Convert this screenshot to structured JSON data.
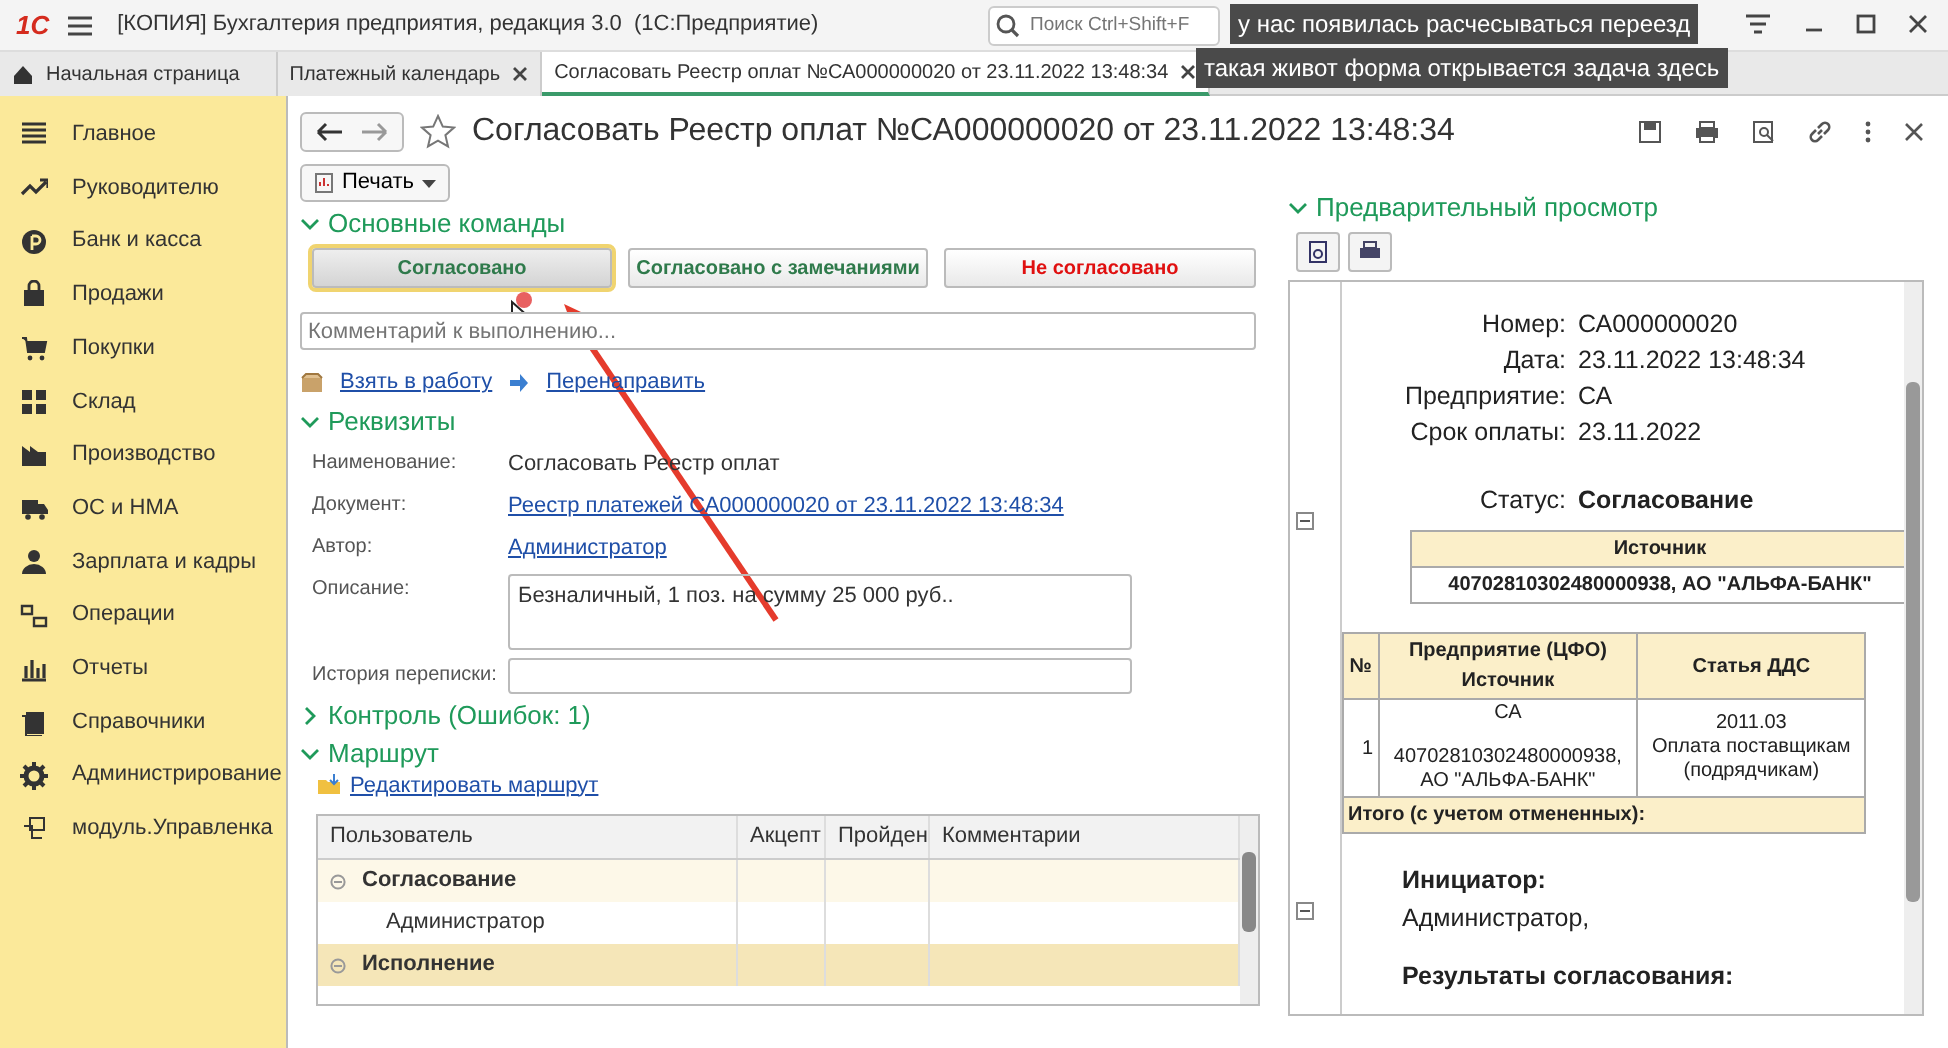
{
  "window": {
    "logo": "1С",
    "title": "[КОПИЯ] Бухгалтерия предприятия, редакция 3.0  (1С:Предприятие)",
    "search": {
      "placeholder": "Поиск Ctrl+Shift+F"
    }
  },
  "captions": [
    "у нас появилась расчесываться переезд",
    "такая живот форма открывается задача здесь"
  ],
  "tabs": [
    {
      "label": "Начальная страница",
      "kind": "home",
      "selected": false
    },
    {
      "label": "Платежный календарь",
      "kind": "closable",
      "selected": false
    },
    {
      "label": "Согласовать Реестр оплат №СА000000020 от 23.11.2022 13:48:34",
      "kind": "closable",
      "selected": true
    }
  ],
  "sidebar": {
    "items": [
      {
        "label": "Главное"
      },
      {
        "label": "Руководителю"
      },
      {
        "label": "Банк и касса"
      },
      {
        "label": "Продажи"
      },
      {
        "label": "Покупки"
      },
      {
        "label": "Склад"
      },
      {
        "label": "Производство"
      },
      {
        "label": "ОС и НМА"
      },
      {
        "label": "Зарплата и кадры"
      },
      {
        "label": "Операции"
      },
      {
        "label": "Отчеты"
      },
      {
        "label": "Справочники"
      },
      {
        "label": "Администрирование"
      },
      {
        "label": "модуль.Управленка"
      }
    ]
  },
  "form": {
    "title": "Согласовать Реестр оплат №СА000000020 от 23.11.2022 13:48:34",
    "starred": false,
    "print_button": "Печать",
    "main_commands": {
      "title": "Основные команды",
      "expanded": true,
      "buttons": [
        {
          "label": "Согласовано",
          "kind": "approve",
          "selected": true
        },
        {
          "label": "Согласовано с замечаниями",
          "kind": "approve",
          "selected": false
        },
        {
          "label": "Не согласовано",
          "kind": "reject",
          "selected": false
        }
      ]
    },
    "comment": {
      "placeholder": "Комментарий к выполнению..."
    },
    "actions": [
      {
        "label": "Взять в работу",
        "kind": "take"
      },
      {
        "label": "Перенаправить",
        "kind": "forward"
      }
    ],
    "requisites": {
      "title": "Реквизиты",
      "expanded": true,
      "fields": [
        {
          "label": "Наименование:",
          "kind": "text",
          "value": "Согласовать Реестр оплат"
        },
        {
          "label": "Документ:",
          "kind": "link",
          "value": "Реестр платежей СА000000020 от 23.11.2022 13:48:34"
        },
        {
          "label": "Автор:",
          "kind": "link",
          "value": "Администратор"
        },
        {
          "label": "Описание:",
          "kind": "textarea",
          "value": "Безналичный, 1 поз. на сумму 25 000 руб.."
        },
        {
          "label": "История переписки:",
          "kind": "input"
        }
      ]
    },
    "control": {
      "title": "Контроль (Ошибок: 1)",
      "expanded": false
    },
    "route": {
      "title": "Маршрут",
      "expanded": true,
      "edit_link": "Редактировать маршрут",
      "table": {
        "columns": [
          "Пользователь",
          "Акцепт",
          "Пройден",
          "Комментарии"
        ],
        "rows": [
          {
            "user": "Согласование",
            "kind": "group",
            "selected": false
          },
          {
            "user": "Администратор",
            "kind": "item",
            "selected": false
          },
          {
            "user": "Исполнение",
            "kind": "group",
            "selected": true
          }
        ]
      }
    }
  },
  "preview": {
    "title": "Предварительный просмотр",
    "expanded": true,
    "header_fields": [
      {
        "label": "Номер:",
        "value": "СА000000020"
      },
      {
        "label": "Дата:",
        "value": "23.11.2022 13:48:34"
      },
      {
        "label": "Предприятие:",
        "value": "СА"
      },
      {
        "label": "Срок оплаты:",
        "value": "23.11.2022"
      }
    ],
    "status_label": "Статус:",
    "status": "Согласование",
    "source_header": "Источник",
    "source_value": "40702810302480000938, АО \"АЛЬФА-БАНК\"",
    "table": {
      "columns": [
        "№",
        "Предприятие (ЦФО)\nИсточник",
        "Статья ДДС"
      ],
      "rows": [
        {
          "number": "1",
          "enterprise": "СА",
          "source": "40702810302480000938,\nАО \"АЛЬФА-БАНК\"",
          "article_code": "2011.03",
          "article_name": "Оплата поставщикам\n(подрядчикам)"
        }
      ],
      "total": "Итого (с учетом отмененных):"
    },
    "initiator_label": "Инициатор:",
    "initiator": "Администратор,",
    "results_label": "Результаты согласования:"
  }
}
